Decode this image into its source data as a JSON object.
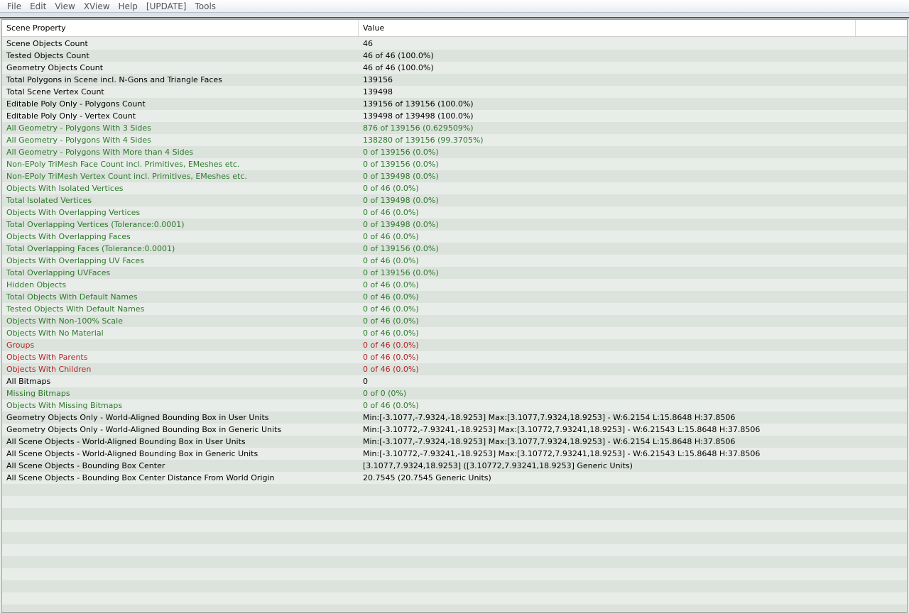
{
  "menu": [
    "File",
    "Edit",
    "View",
    "XView",
    "Help",
    "[UPDATE]",
    "Tools"
  ],
  "colors": {
    "black": "#000000",
    "green": "#2c7a2c",
    "red": "#b02424"
  },
  "table": {
    "headers": [
      "Scene Property",
      "Value",
      ""
    ],
    "rows": [
      {
        "property": "Scene Objects Count",
        "value": "46",
        "color": "black"
      },
      {
        "property": "Tested Objects Count",
        "value": "46 of 46 (100.0%)",
        "color": "black"
      },
      {
        "property": "Geometry Objects Count",
        "value": "46 of 46 (100.0%)",
        "color": "black"
      },
      {
        "property": "Total Polygons in Scene incl. N-Gons and Triangle Faces",
        "value": "139156",
        "color": "black"
      },
      {
        "property": "Total Scene Vertex Count",
        "value": "139498",
        "color": "black"
      },
      {
        "property": "Editable Poly Only - Polygons Count",
        "value": "139156 of 139156 (100.0%)",
        "color": "black"
      },
      {
        "property": "Editable Poly Only - Vertex Count",
        "value": "139498 of 139498 (100.0%)",
        "color": "black"
      },
      {
        "property": "All Geometry - Polygons With 3 Sides",
        "value": "876 of 139156 (0.629509%)",
        "color": "green"
      },
      {
        "property": "All Geometry - Polygons With 4 Sides",
        "value": "138280 of 139156 (99.3705%)",
        "color": "green"
      },
      {
        "property": "All Geometry - Polygons With More than 4 Sides",
        "value": "0 of 139156 (0.0%)",
        "color": "green"
      },
      {
        "property": "Non-EPoly TriMesh Face Count incl. Primitives, EMeshes etc.",
        "value": "0 of 139156 (0.0%)",
        "color": "green"
      },
      {
        "property": "Non-EPoly TriMesh Vertex Count incl. Primitives, EMeshes etc.",
        "value": "0 of 139498 (0.0%)",
        "color": "green"
      },
      {
        "property": "Objects With Isolated Vertices",
        "value": "0 of 46 (0.0%)",
        "color": "green"
      },
      {
        "property": "Total Isolated Vertices",
        "value": "0 of 139498 (0.0%)",
        "color": "green"
      },
      {
        "property": "Objects With Overlapping Vertices",
        "value": "0 of 46 (0.0%)",
        "color": "green"
      },
      {
        "property": "Total Overlapping Vertices (Tolerance:0.0001)",
        "value": "0 of 139498 (0.0%)",
        "color": "green"
      },
      {
        "property": "Objects With Overlapping Faces",
        "value": "0 of 46 (0.0%)",
        "color": "green"
      },
      {
        "property": "Total Overlapping Faces (Tolerance:0.0001)",
        "value": "0 of 139156 (0.0%)",
        "color": "green"
      },
      {
        "property": "Objects With Overlapping UV Faces",
        "value": "0 of 46 (0.0%)",
        "color": "green"
      },
      {
        "property": "Total Overlapping UVFaces",
        "value": "0 of 139156 (0.0%)",
        "color": "green"
      },
      {
        "property": "Hidden Objects",
        "value": "0 of 46 (0.0%)",
        "color": "green"
      },
      {
        "property": "Total Objects With Default Names",
        "value": "0 of 46 (0.0%)",
        "color": "green"
      },
      {
        "property": "Tested Objects With Default Names",
        "value": "0 of 46 (0.0%)",
        "color": "green"
      },
      {
        "property": "Objects With Non-100% Scale",
        "value": "0 of 46 (0.0%)",
        "color": "green"
      },
      {
        "property": "Objects With No Material",
        "value": "0 of 46 (0.0%)",
        "color": "green"
      },
      {
        "property": "Groups",
        "value": "0 of 46 (0.0%)",
        "color": "red"
      },
      {
        "property": "Objects With Parents",
        "value": "0 of 46 (0.0%)",
        "color": "red"
      },
      {
        "property": "Objects With Children",
        "value": "0 of 46 (0.0%)",
        "color": "red"
      },
      {
        "property": "All Bitmaps",
        "value": "0",
        "color": "black"
      },
      {
        "property": "Missing Bitmaps",
        "value": "0 of 0 (0%)",
        "color": "green"
      },
      {
        "property": "Objects With Missing Bitmaps",
        "value": "0 of 46 (0.0%)",
        "color": "green"
      },
      {
        "property": "Geometry Objects Only - World-Aligned Bounding Box in User Units",
        "value": "Min:[-3.1077,-7.9324,-18.9253]  Max:[3.1077,7.9324,18.9253] - W:6.2154 L:15.8648 H:37.8506",
        "color": "black"
      },
      {
        "property": "Geometry Objects Only - World-Aligned Bounding Box in Generic Units",
        "value": "Min:[-3.10772,-7.93241,-18.9253]  Max:[3.10772,7.93241,18.9253] - W:6.21543 L:15.8648 H:37.8506",
        "color": "black"
      },
      {
        "property": "All Scene Objects - World-Aligned Bounding Box in User Units",
        "value": "Min:[-3.1077,-7.9324,-18.9253]  Max:[3.1077,7.9324,18.9253] - W:6.2154 L:15.8648 H:37.8506",
        "color": "black"
      },
      {
        "property": "All Scene Objects - World-Aligned Bounding Box in Generic Units",
        "value": "Min:[-3.10772,-7.93241,-18.9253]  Max:[3.10772,7.93241,18.9253] - W:6.21543 L:15.8648 H:37.8506",
        "color": "black"
      },
      {
        "property": "All Scene Objects - Bounding Box Center",
        "value": "[3.1077,7.9324,18.9253]   ([3.10772,7.93241,18.9253] Generic Units)",
        "color": "black"
      },
      {
        "property": "All Scene Objects - Bounding Box Center Distance From World Origin",
        "value": "20.7545  (20.7545 Generic Units)",
        "color": "black"
      },
      {
        "property": "",
        "value": "",
        "color": "black"
      },
      {
        "property": "",
        "value": "",
        "color": "black"
      },
      {
        "property": "",
        "value": "",
        "color": "black"
      },
      {
        "property": "",
        "value": "",
        "color": "black"
      },
      {
        "property": "",
        "value": "",
        "color": "black"
      },
      {
        "property": "",
        "value": "",
        "color": "black"
      },
      {
        "property": "",
        "value": "",
        "color": "black"
      },
      {
        "property": "",
        "value": "",
        "color": "black"
      },
      {
        "property": "",
        "value": "",
        "color": "black"
      },
      {
        "property": "",
        "value": "",
        "color": "black"
      },
      {
        "property": "",
        "value": "",
        "color": "black"
      },
      {
        "property": "",
        "value": "",
        "color": "black"
      }
    ]
  }
}
